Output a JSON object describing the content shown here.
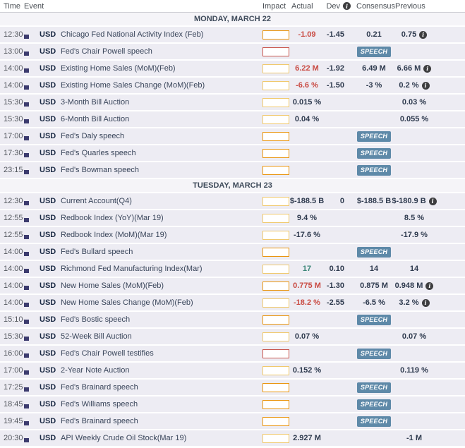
{
  "columns": {
    "time": "Time",
    "event": "Event",
    "impact": "Impact",
    "actual": "Actual",
    "dev": "Dev",
    "consensus": "Consensus",
    "previous": "Previous"
  },
  "icons": {
    "info_icon_glyph": "i",
    "flag": "us-flag"
  },
  "speech_label": "SPEECH",
  "colors": {
    "actual_negative": "#c94a42",
    "actual_positive": "#3a8577",
    "actual_neutral": "#2e3a4e",
    "speech_badge": "#5e89a8",
    "info_icon": "#3d3d3f",
    "row_background": "#edecf3",
    "day_header_background": "#f5f4f8"
  },
  "impact_levels": {
    "low": {
      "color": "#f0c96d",
      "fill": "34%"
    },
    "medium": {
      "color": "#e9950f",
      "fill": "70%"
    },
    "high": {
      "color": "#c9564d",
      "fill": "100%"
    }
  },
  "sections": [
    {
      "title": "MONDAY, MARCH 22",
      "rows": [
        {
          "time": "12:30",
          "currency": "USD",
          "event": "Chicago Fed National Activity Index (Feb)",
          "impact": "medium",
          "actual": "-1.09",
          "actual_tone": "negative",
          "dev": "-1.45",
          "consensus": "0.21",
          "previous": "0.75",
          "previous_info": true
        },
        {
          "time": "13:00",
          "currency": "USD",
          "event": "Fed's Chair Powell speech",
          "impact": "high",
          "speech": true
        },
        {
          "time": "14:00",
          "currency": "USD",
          "event": "Existing Home Sales (MoM)(Feb)",
          "impact": "low",
          "actual": "6.22 M",
          "actual_tone": "negative",
          "dev": "-1.92",
          "consensus": "6.49 M",
          "previous": "6.66 M",
          "previous_info": true
        },
        {
          "time": "14:00",
          "currency": "USD",
          "event": "Existing Home Sales Change (MoM)(Feb)",
          "impact": "low",
          "actual": "-6.6 %",
          "actual_tone": "negative",
          "dev": "-1.50",
          "consensus": "-3 %",
          "previous": "0.2 %",
          "previous_info": true
        },
        {
          "time": "15:30",
          "currency": "USD",
          "event": "3-Month Bill Auction",
          "impact": "low",
          "actual": "0.015 %",
          "actual_tone": "neutral",
          "previous": "0.03 %"
        },
        {
          "time": "15:30",
          "currency": "USD",
          "event": "6-Month Bill Auction",
          "impact": "low",
          "actual": "0.04 %",
          "actual_tone": "neutral",
          "previous": "0.055 %"
        },
        {
          "time": "17:00",
          "currency": "USD",
          "event": "Fed's Daly speech",
          "impact": "medium",
          "speech": true
        },
        {
          "time": "17:30",
          "currency": "USD",
          "event": "Fed's Quarles speech",
          "impact": "medium",
          "speech": true
        },
        {
          "time": "23:15",
          "currency": "USD",
          "event": "Fed's Bowman speech",
          "impact": "medium",
          "speech": true
        }
      ]
    },
    {
      "title": "TUESDAY, MARCH 23",
      "rows": [
        {
          "time": "12:30",
          "currency": "USD",
          "event": "Current Account(Q4)",
          "impact": "low",
          "actual": "$-188.5 B",
          "actual_tone": "neutral",
          "dev": "0",
          "consensus": "$-188.5 B",
          "previous": "$-180.9 B",
          "previous_info": true
        },
        {
          "time": "12:55",
          "currency": "USD",
          "event": "Redbook Index (YoY)(Mar 19)",
          "impact": "low",
          "actual": "9.4 %",
          "actual_tone": "neutral",
          "previous": "8.5 %"
        },
        {
          "time": "12:55",
          "currency": "USD",
          "event": "Redbook Index (MoM)(Mar 19)",
          "impact": "low",
          "actual": "-17.6 %",
          "actual_tone": "neutral",
          "previous": "-17.9 %"
        },
        {
          "time": "14:00",
          "currency": "USD",
          "event": "Fed's Bullard speech",
          "impact": "medium",
          "speech": true
        },
        {
          "time": "14:00",
          "currency": "USD",
          "event": "Richmond Fed Manufacturing Index(Mar)",
          "impact": "low",
          "actual": "17",
          "actual_tone": "positive",
          "dev": "0.10",
          "consensus": "14",
          "previous": "14"
        },
        {
          "time": "14:00",
          "currency": "USD",
          "event": "New Home Sales (MoM)(Feb)",
          "impact": "medium",
          "actual": "0.775 M",
          "actual_tone": "negative",
          "dev": "-1.30",
          "consensus": "0.875 M",
          "previous": "0.948 M",
          "previous_info": true
        },
        {
          "time": "14:00",
          "currency": "USD",
          "event": "New Home Sales Change (MoM)(Feb)",
          "impact": "low",
          "actual": "-18.2 %",
          "actual_tone": "negative",
          "dev": "-2.55",
          "consensus": "-6.5 %",
          "previous": "3.2 %",
          "previous_info": true
        },
        {
          "time": "15:10",
          "currency": "USD",
          "event": "Fed's Bostic speech",
          "impact": "medium",
          "speech": true
        },
        {
          "time": "15:30",
          "currency": "USD",
          "event": "52-Week Bill Auction",
          "impact": "low",
          "actual": "0.07 %",
          "actual_tone": "neutral",
          "previous": "0.07 %"
        },
        {
          "time": "16:00",
          "currency": "USD",
          "event": "Fed's Chair Powell testifies",
          "impact": "high",
          "speech": true
        },
        {
          "time": "17:00",
          "currency": "USD",
          "event": "2-Year Note Auction",
          "impact": "low",
          "actual": "0.152 %",
          "actual_tone": "neutral",
          "previous": "0.119 %"
        },
        {
          "time": "17:25",
          "currency": "USD",
          "event": "Fed's Brainard speech",
          "impact": "medium",
          "speech": true
        },
        {
          "time": "18:45",
          "currency": "USD",
          "event": "Fed's Williams speech",
          "impact": "medium",
          "speech": true
        },
        {
          "time": "19:45",
          "currency": "USD",
          "event": "Fed's Brainard speech",
          "impact": "medium",
          "speech": true
        },
        {
          "time": "20:30",
          "currency": "USD",
          "event": "API Weekly Crude Oil Stock(Mar 19)",
          "impact": "low",
          "actual": "2.927 M",
          "actual_tone": "neutral",
          "previous": "-1 M"
        }
      ]
    }
  ]
}
